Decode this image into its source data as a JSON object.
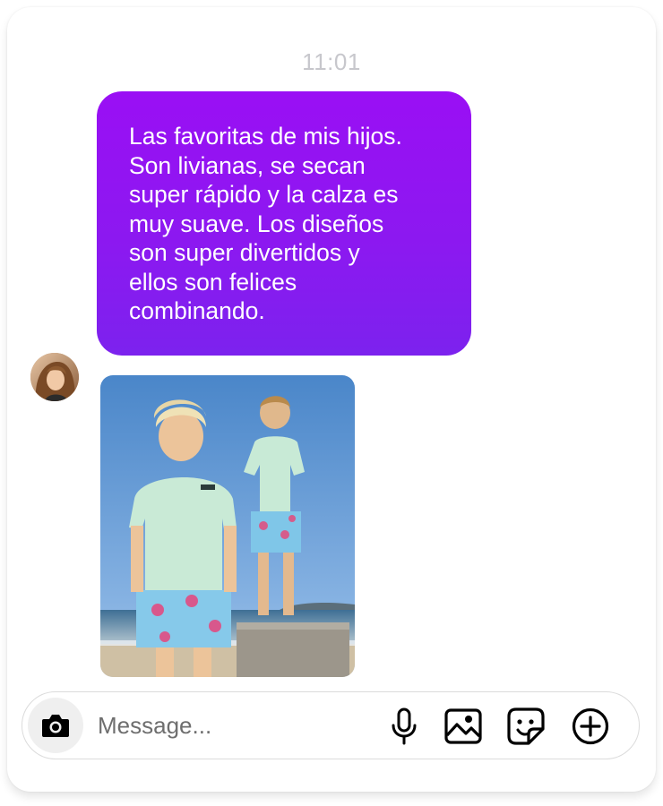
{
  "thread": {
    "timestamp": "11:01"
  },
  "message": {
    "text": "Las favoritas de mis hijos.\nSon livianas, se secan\nsuper rápido y la calza es\nmuy suave. Los diseños\nson super divertidos y\nellos son felices\ncombinando."
  },
  "composer": {
    "placeholder": "Message..."
  },
  "icons": {
    "camera": "camera-icon",
    "microphone": "microphone-icon",
    "gallery": "image-icon",
    "sticker": "sticker-icon",
    "more": "plus-circle-icon"
  },
  "colors": {
    "bubble_top": "#9a0ff4",
    "bubble_bottom": "#7c22ee",
    "timestamp": "#c7c7cc",
    "icon": "#000000"
  }
}
